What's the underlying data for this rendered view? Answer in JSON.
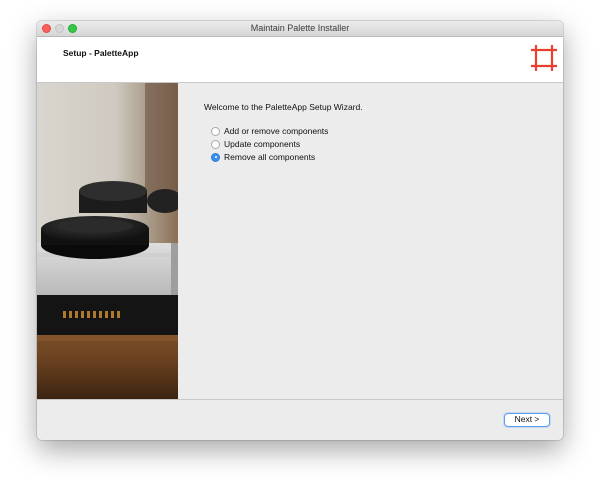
{
  "window": {
    "title": "Maintain Palette Installer"
  },
  "header": {
    "title": "Setup - PaletteApp",
    "logo_icon": "palette-frame-icon",
    "logo_color": "#e8402f"
  },
  "content": {
    "welcome_text": "Welcome to the PaletteApp Setup Wizard.",
    "options": [
      {
        "label": "Add or remove components",
        "selected": false
      },
      {
        "label": "Update components",
        "selected": false
      },
      {
        "label": "Remove all components",
        "selected": true
      }
    ]
  },
  "footer": {
    "next_label": "Next >"
  },
  "colors": {
    "accent": "#3b8ef0",
    "window_bg": "#ececec"
  }
}
